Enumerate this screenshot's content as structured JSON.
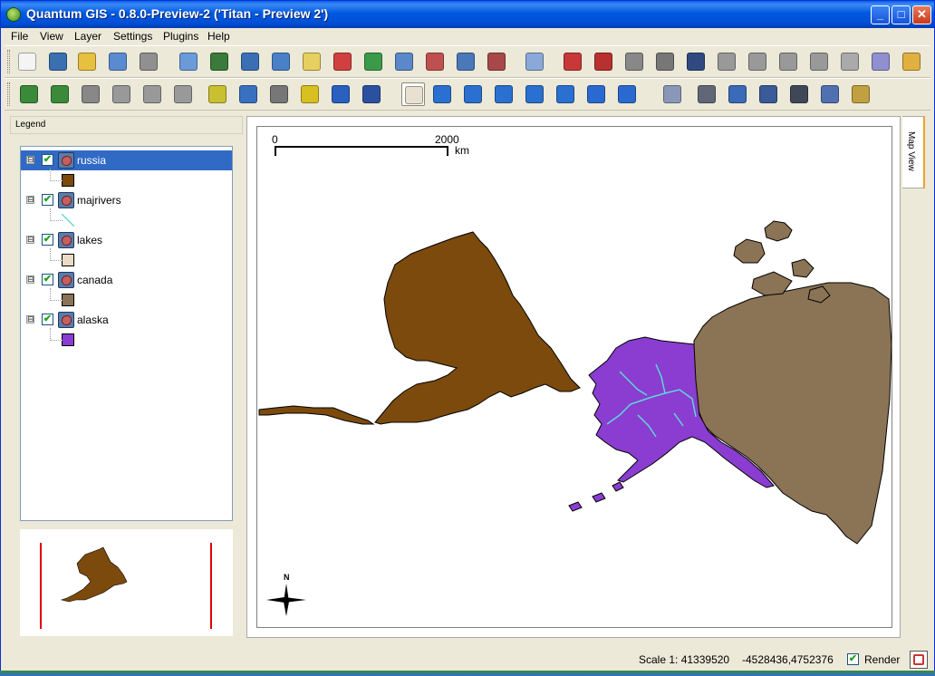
{
  "window": {
    "title": "Quantum GIS - 0.8.0-Preview-2 ('Titan - Preview 2')"
  },
  "menu": [
    "File",
    "View",
    "Layer",
    "Settings",
    "Plugins",
    "Help"
  ],
  "toolbar1": [
    {
      "icon": "new-project-icon",
      "color": "#f4f4f4"
    },
    {
      "icon": "save-project-icon",
      "color": "#3a6fb0"
    },
    {
      "icon": "save-as-icon",
      "color": "#e8c040"
    },
    {
      "icon": "open-project-icon",
      "color": "#5a8ad0"
    },
    {
      "icon": "print-icon",
      "color": "#909090"
    },
    {
      "icon": "add-raster-icon",
      "color": "#6a9ad8"
    },
    {
      "icon": "add-raster-alt-icon",
      "color": "#3a7a3a"
    },
    {
      "icon": "add-postgis-icon",
      "color": "#3b6fb5"
    },
    {
      "icon": "add-wms-icon",
      "color": "#4a80c8"
    },
    {
      "icon": "new-vector-icon",
      "color": "#e8d060"
    },
    {
      "icon": "remove-layer-icon",
      "color": "#d04040"
    },
    {
      "icon": "refresh-layers-icon",
      "color": "#3a9a4a"
    },
    {
      "icon": "layer-star-icon",
      "color": "#5a88c8"
    },
    {
      "icon": "layer-remove-icon",
      "color": "#c05050"
    },
    {
      "icon": "show-all-icon",
      "color": "#4a78b8"
    },
    {
      "icon": "hide-all-icon",
      "color": "#a84848"
    },
    {
      "icon": "capture-icon",
      "color": "#8aa8d8"
    },
    {
      "icon": "digitize-point-icon",
      "color": "#c83838"
    },
    {
      "icon": "digitize-line-icon",
      "color": "#b83030"
    },
    {
      "icon": "digitize-polygon-icon",
      "color": "#888"
    },
    {
      "icon": "delete-feature-icon",
      "color": "#777"
    },
    {
      "icon": "move-feature-icon",
      "color": "#304a80"
    },
    {
      "icon": "split-feature-icon",
      "color": "#999"
    },
    {
      "icon": "add-vertex-icon",
      "color": "#999"
    },
    {
      "icon": "delete-vertex-icon",
      "color": "#999"
    },
    {
      "icon": "move-vertex-icon",
      "color": "#999"
    },
    {
      "icon": "cut-icon",
      "color": "#aaa"
    },
    {
      "icon": "copy-icon",
      "color": "#9090d0"
    },
    {
      "icon": "paste-icon",
      "color": "#e0b040"
    }
  ],
  "toolbar2": [
    {
      "icon": "plugin-grid-icon",
      "color": "#3a8a3a",
      "active": false
    },
    {
      "icon": "plugin-georef-icon",
      "color": "#3a8a3a",
      "active": false
    },
    {
      "icon": "plugin-tools-icon",
      "color": "#888",
      "active": false
    },
    {
      "icon": "plugin-copyright-icon",
      "color": "#999",
      "active": false
    },
    {
      "icon": "plugin-scalebar-icon",
      "color": "#999",
      "active": false
    },
    {
      "icon": "plugin-north-icon",
      "color": "#999",
      "active": false
    },
    {
      "icon": "plugin-delimited-icon",
      "color": "#c8c030",
      "active": false
    },
    {
      "icon": "plugin-globe-icon",
      "color": "#3a70c0",
      "active": false
    },
    {
      "icon": "plugin-gps-icon",
      "color": "#777",
      "active": false
    },
    {
      "icon": "plugin-graticule-icon",
      "color": "#d8c020",
      "active": false
    },
    {
      "icon": "north-arrow-icon",
      "color": "#2a60c0",
      "active": false
    },
    {
      "icon": "scale-bar-icon",
      "color": "#2a50a0",
      "active": false
    },
    {
      "icon": "pan-icon",
      "color": "#e8e0d0",
      "active": true
    },
    {
      "icon": "zoom-in-icon",
      "color": "#2a70d0",
      "active": false
    },
    {
      "icon": "zoom-out-icon",
      "color": "#2a70d0",
      "active": false
    },
    {
      "icon": "zoom-full-icon",
      "color": "#2a70d0",
      "active": false
    },
    {
      "icon": "zoom-layer-icon",
      "color": "#2a70d0",
      "active": false
    },
    {
      "icon": "zoom-last-icon",
      "color": "#2a70d0",
      "active": false
    },
    {
      "icon": "back-icon",
      "color": "#2a6ad0",
      "active": false
    },
    {
      "icon": "refresh-icon",
      "color": "#2a6ad0",
      "active": false
    },
    {
      "icon": "identify-icon",
      "color": "#8a98b8",
      "active": false
    },
    {
      "icon": "select-icon",
      "color": "#606878",
      "active": false
    },
    {
      "icon": "attribute-table-icon",
      "color": "#3a6ab8",
      "active": false
    },
    {
      "icon": "measure-icon",
      "color": "#3a5a98",
      "active": false
    },
    {
      "icon": "map-tips-icon",
      "color": "#404858",
      "active": false
    },
    {
      "icon": "add-user-icon",
      "color": "#5070b0",
      "active": false
    },
    {
      "icon": "user-group-icon",
      "color": "#c0a040",
      "active": false
    }
  ],
  "legend": {
    "title": "Legend",
    "layers": [
      {
        "name": "russia",
        "checked": "✔",
        "expander": "⊟",
        "color": "#7b4a0c",
        "selected": true
      },
      {
        "name": "majrivers",
        "checked": "✔",
        "expander": "⊟",
        "color": "#5fd7d7",
        "selected": false,
        "line": true
      },
      {
        "name": "lakes",
        "checked": "✔",
        "expander": "⊟",
        "color": "#eadbc8",
        "selected": false
      },
      {
        "name": "canada",
        "checked": "✔",
        "expander": "⊟",
        "color": "#8b7355",
        "selected": false
      },
      {
        "name": "alaska",
        "checked": "✔",
        "expander": "⊟",
        "color": "#8a3dd0",
        "selected": false
      }
    ]
  },
  "map": {
    "scalebar": {
      "start": "0",
      "end": "2000",
      "unit": "km"
    },
    "north_label": "N",
    "tab_label": "Map View"
  },
  "status": {
    "scale": "Scale 1: 41339520",
    "coordinates": "-4528436,4752376",
    "render_label": "Render",
    "render_checked": "✔"
  }
}
